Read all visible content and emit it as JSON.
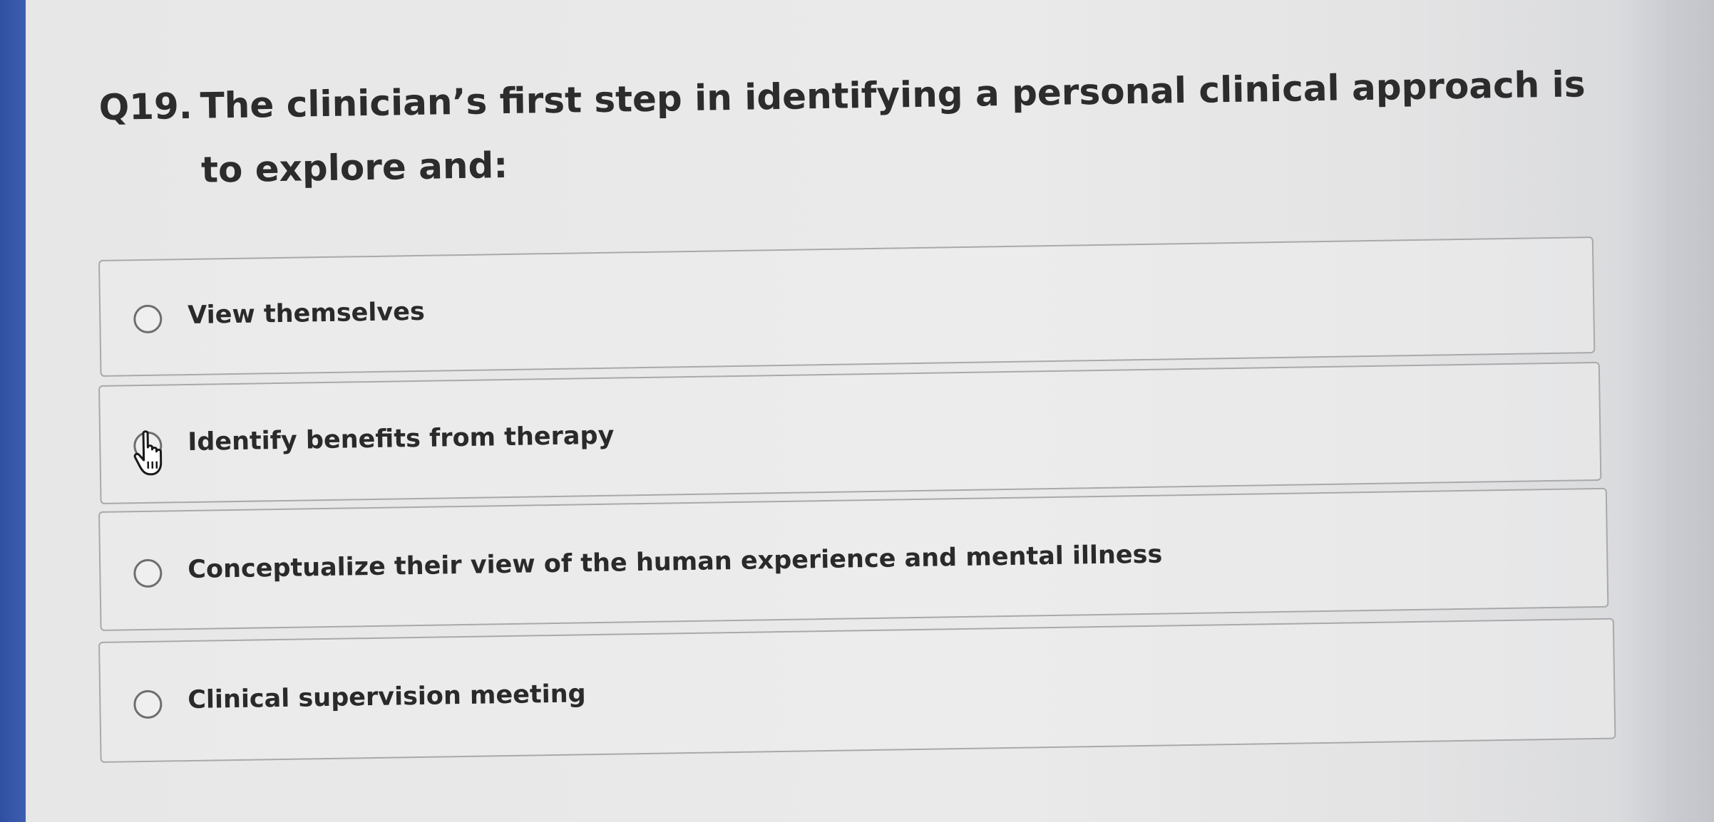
{
  "question": {
    "number": "Q19.",
    "text": "The clinician’s first step in identifying a personal clinical approach is to explore and:"
  },
  "options": [
    {
      "label": "View themselves"
    },
    {
      "label": "Identify benefits from therapy"
    },
    {
      "label": "Conceptualize their view of the human experience and mental illness"
    },
    {
      "label": "Clinical supervision meeting"
    }
  ],
  "icons": {
    "cursor": "hand-pointer-icon"
  },
  "colors": {
    "page_background": "#e8e8e8",
    "left_edge_blue": "#3452a6",
    "text": "#2a2a2a",
    "option_border": "#a9a9ab"
  }
}
